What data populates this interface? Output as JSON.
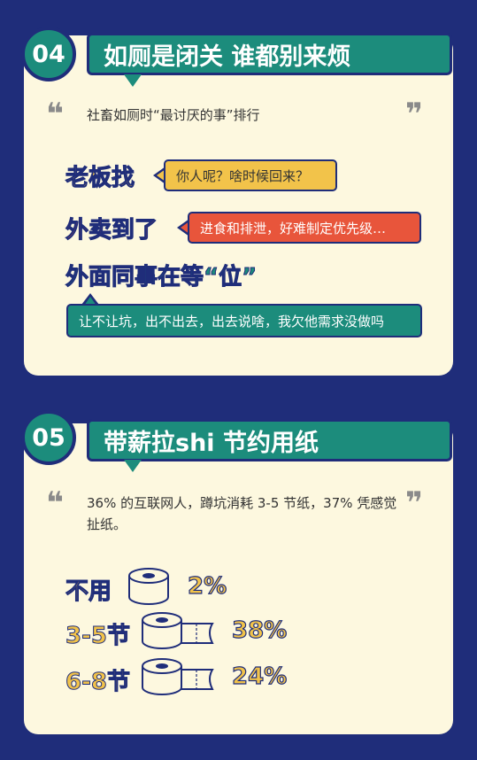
{
  "section1": {
    "number": "04",
    "title": "如厕是闭关 谁都别来烦",
    "intro": "社畜如厕时“最讨厌的事”排行",
    "quote_open": "❝",
    "quote_close": "❞",
    "items": [
      {
        "label": "老板找",
        "bubble": "你人呢？啥时候回来？"
      },
      {
        "label": "外卖到了",
        "bubble": "进食和排泄，好难制定优先级…"
      },
      {
        "label": "外面同事在等“位”",
        "bubble": "让不让坑，出不出去，出去说啥，我欠他需求没做吗"
      }
    ]
  },
  "section2": {
    "number": "05",
    "title": "带薪拉shi 节约用纸",
    "intro": "36% 的互联网人，蹲坑消耗 3-5 节纸，37% 凭感觉扯纸。",
    "quote_open": "❝",
    "quote_close": "❞",
    "rows": [
      {
        "label": "不用",
        "value": "2%"
      },
      {
        "label": "3-5节",
        "value": "38%"
      },
      {
        "label": "6-8节",
        "value": "24%"
      }
    ]
  },
  "colors": {
    "background": "#1f2d7a",
    "card": "#fdf8df",
    "teal": "#1c8c7c",
    "yellow": "#f2c34a",
    "red": "#e8553b"
  }
}
